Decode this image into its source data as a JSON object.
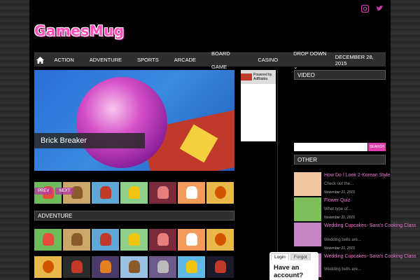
{
  "social": {
    "icons": [
      "instagram-icon",
      "twitter-icon"
    ],
    "color": "#ff3fbf"
  },
  "site": {
    "logo": "GamesMug"
  },
  "nav": {
    "items": [
      "ACTION",
      "ADVENTURE",
      "SPORTS",
      "ARCADE",
      "BOARD GAME",
      "CASINO",
      "DROP DOWN"
    ],
    "dropdown_caret": "⌄",
    "date": "DECEMBER 28, 2015"
  },
  "slider": {
    "caption": "Brick Breaker",
    "prev": "PREV",
    "next": "NEXT"
  },
  "ad": {
    "line1": "Powered by",
    "line2": "AdBlabla"
  },
  "sections": {
    "adventure": "ADVENTURE",
    "video": "VIDEO",
    "other": "OTHER"
  },
  "search": {
    "button": "SEARCH",
    "placeholder": ""
  },
  "other": [
    {
      "title": "How Do I Look 2-Korean Style",
      "snippet": "Check out the...",
      "date": "November 21, 2015"
    },
    {
      "title": "Flower Quiz",
      "snippet": "What type of...",
      "date": "November 21, 2015"
    },
    {
      "title": "Wedding Cupcakes- Sara's Cooking Class",
      "snippet": "Wedding bells are...",
      "date": "November 21, 2015"
    },
    {
      "title": "Wedding Cupcakes- Sara's Cooking Class",
      "snippet": "Wedding bells are...",
      "date": ""
    }
  ],
  "login": {
    "tab_login": "Login",
    "tab_forgot": "Forgot",
    "heading": "Have an account?"
  },
  "colors": {
    "accent": "#e040b0",
    "navbar": "#2e2e2e"
  }
}
